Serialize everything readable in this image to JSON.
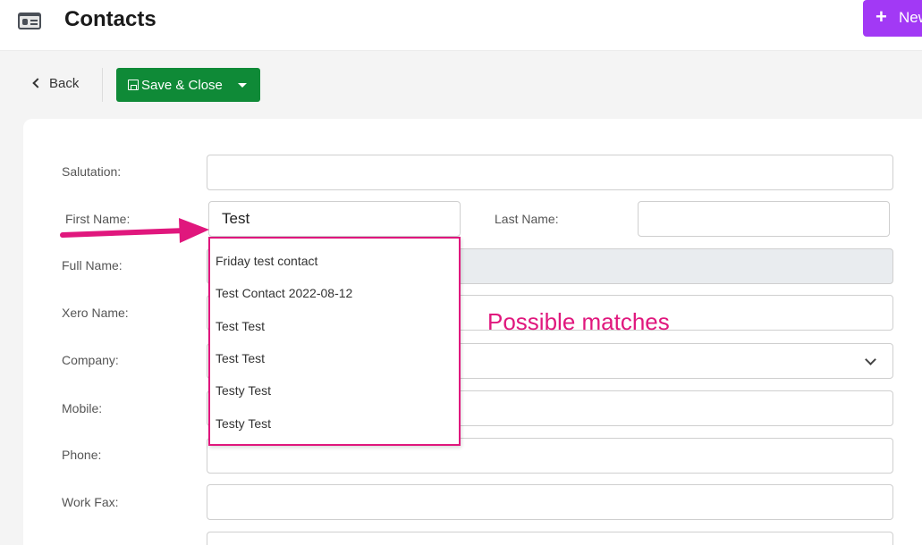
{
  "header": {
    "title": "Contacts",
    "new_button_label": "New"
  },
  "toolbar": {
    "back_label": "Back",
    "save_label": "Save & Close"
  },
  "form": {
    "salutation": {
      "label": "Salutation:",
      "value": ""
    },
    "first_name": {
      "label": "First Name:",
      "value": "Test"
    },
    "last_name": {
      "label": "Last Name:",
      "value": ""
    },
    "full_name": {
      "label": "Full Name:",
      "value": ""
    },
    "xero_name": {
      "label": "Xero Name:",
      "value": ""
    },
    "company": {
      "label": "Company:",
      "value": ""
    },
    "mobile": {
      "label": "Mobile:",
      "value": ""
    },
    "phone": {
      "label": "Phone:",
      "value": ""
    },
    "work_fax": {
      "label": "Work Fax:",
      "value": ""
    }
  },
  "suggestions": [
    "Friday test contact",
    "Test Contact 2022-08-12",
    "Test Test",
    "Test Test",
    "Testy Test",
    "Testy Test"
  ],
  "annotation": {
    "text": "Possible matches",
    "color": "#e0177d"
  },
  "colors": {
    "accent_purple": "#a239f5",
    "save_green": "#0f8a37"
  }
}
